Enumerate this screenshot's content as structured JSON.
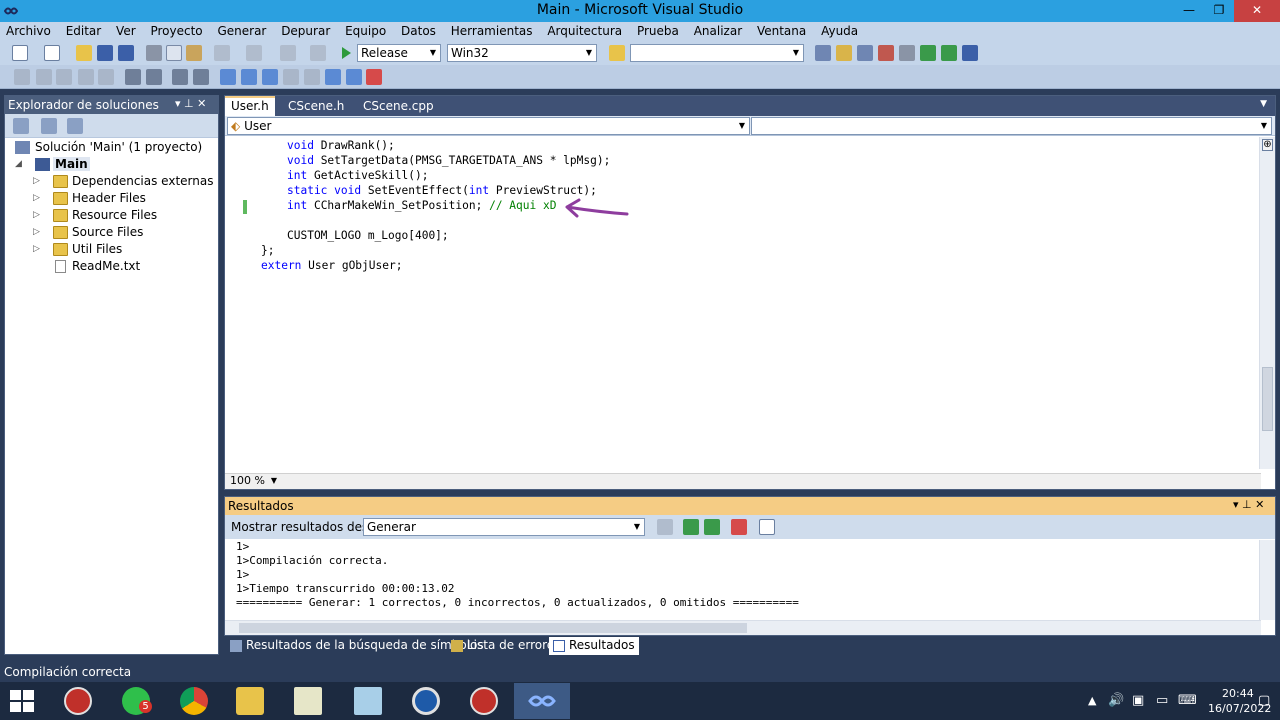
{
  "window": {
    "title": "Main - Microsoft Visual Studio",
    "minimize": "—",
    "restore": "❐",
    "close": "✕"
  },
  "menu": [
    "Archivo",
    "Editar",
    "Ver",
    "Proyecto",
    "Generar",
    "Depurar",
    "Equipo",
    "Datos",
    "Herramientas",
    "Arquitectura",
    "Prueba",
    "Analizar",
    "Ventana",
    "Ayuda"
  ],
  "toolbar": {
    "configuration": "Release",
    "platform": "Win32",
    "find_value": ""
  },
  "solution_explorer": {
    "title": "Explorador de soluciones",
    "pin": "▾ ⊥ ✕",
    "tree": {
      "solution": "Solución 'Main'  (1 proyecto)",
      "project": "Main",
      "items": [
        "Dependencias externas",
        "Header Files",
        "Resource Files",
        "Source Files",
        "Util Files"
      ],
      "file": "ReadMe.txt"
    }
  },
  "editor": {
    "tabs": [
      "User.h",
      "CScene.h",
      "CScene.cpp"
    ],
    "active_tab": "User.h",
    "nav_left": "User",
    "nav_right": "",
    "zoom": "100 %",
    "code": {
      "l1_kw": "void",
      "l1_rest": " DrawRank();",
      "l2_kw": "void",
      "l2_rest": " SetTargetData(PMSG_TARGETDATA_ANS * lpMsg);",
      "l3_kw": "int",
      "l3_rest": " GetActiveSkill();",
      "l4_kw1": "static",
      "l4_kw2": "void",
      "l4_mid": " SetEventEffect(",
      "l4_kw3": "int",
      "l4_rest": " PreviewStruct);",
      "l5_kw": "int",
      "l5_rest": " CCharMakeWin_SetPosition; ",
      "l5_comment": "// Aqui xD",
      "l6": "CUSTOM_LOGO m_Logo[400];",
      "l7": "};",
      "l8_kw": "extern",
      "l8_rest": " User gObjUser;"
    },
    "annotation_color": "#8e3d9e"
  },
  "results": {
    "title": "Resultados",
    "show_from_label": "Mostrar resultados desde:",
    "show_from_value": "Generar",
    "lines": [
      "1>",
      "1>Compilación correcta.",
      "1>",
      "1>Tiempo transcurrido 00:00:13.02",
      "========== Generar: 1 correctos, 0 incorrectos, 0 actualizados, 0 omitidos =========="
    ]
  },
  "bottom_tabs": [
    "Resultados de la búsqueda de símbolos",
    "Lista de errores",
    "Resultados"
  ],
  "status": "Compilación correcta",
  "taskbar": {
    "whatsapp_badge": "5",
    "time": "20:44",
    "date": "16/07/2022"
  }
}
